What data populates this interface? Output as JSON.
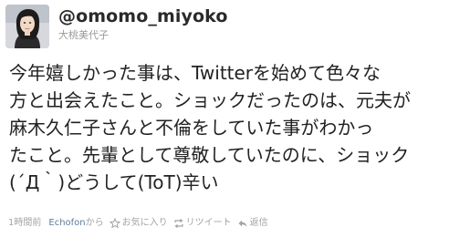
{
  "user": {
    "handle": "@omomo_miyoko",
    "display_name": "大桃美代子",
    "avatar_icon": "profile-photo"
  },
  "tweet": {
    "lines": [
      "今年嬉しかった事は、Twitterを始めて色々な",
      "方と出会えたこと。ショックだったのは、元夫が",
      "麻木久仁子さんと不倫をしていた事がわかっ",
      "たこと。先輩として尊敬していたのに、ショック",
      "(´Д｀)どうして(ToT)辛い"
    ]
  },
  "meta": {
    "time": "1時間前",
    "source": "Echofon",
    "source_suffix": "から",
    "favorite_label": "お気に入り",
    "retweet_label": "リツイート",
    "reply_label": "返信",
    "favorite_icon": "star-icon",
    "retweet_icon": "retweet-icon",
    "reply_icon": "reply-icon"
  },
  "colors": {
    "text": "#222222",
    "muted": "#a3a3a3",
    "link": "#5c7c99"
  }
}
